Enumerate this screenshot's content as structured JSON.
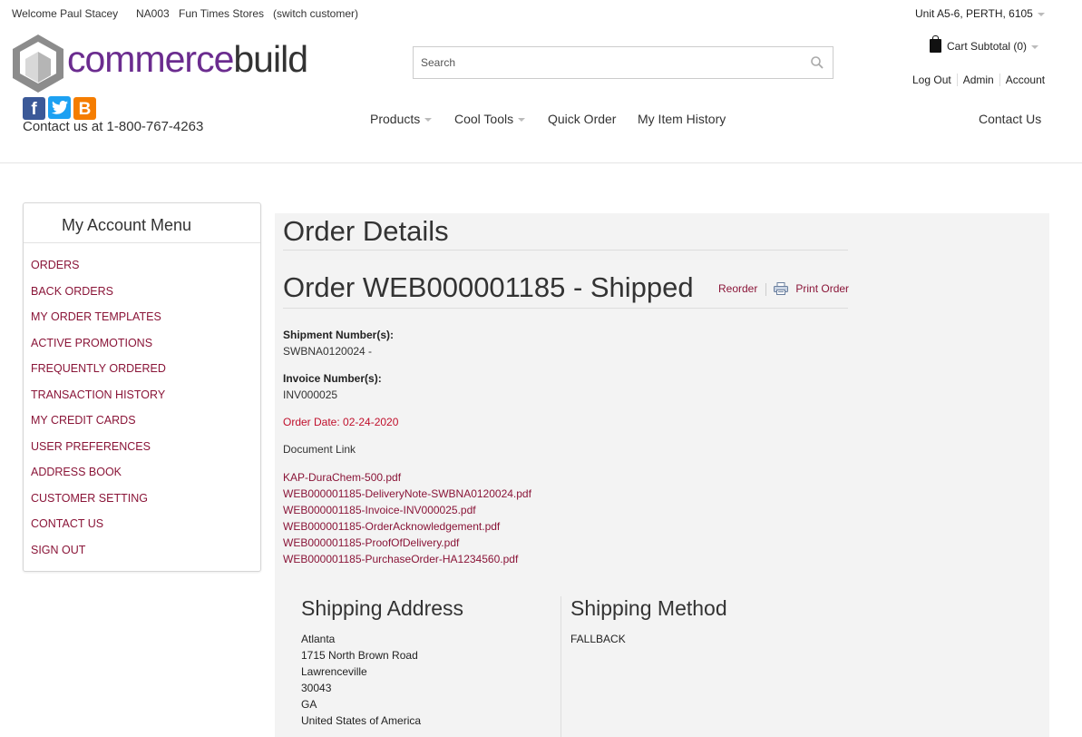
{
  "topbar": {
    "welcome": "Welcome Paul Stacey",
    "customer_code": "NA003",
    "store_name": "Fun Times Stores",
    "switch_label": "(switch customer)",
    "location": "Unit A5-6, PERTH, 6105"
  },
  "logo": {
    "part1": "commerce",
    "part2": "build"
  },
  "social": {
    "facebook": "f",
    "twitter": "t",
    "blogger": "B"
  },
  "contact_line": "Contact us at 1-800-767-4263",
  "search": {
    "placeholder": "Search"
  },
  "cart": {
    "label": "Cart Subtotal (0)"
  },
  "account_links": {
    "logout": "Log Out",
    "admin": "Admin",
    "account": "Account"
  },
  "nav": {
    "products": "Products",
    "cool_tools": "Cool Tools",
    "quick_order": "Quick Order",
    "item_history": "My Item History",
    "contact": "Contact Us"
  },
  "sidebar": {
    "title": "My Account Menu",
    "items": [
      "ORDERS",
      "BACK ORDERS",
      "MY ORDER TEMPLATES",
      "ACTIVE PROMOTIONS",
      "FREQUENTLY ORDERED",
      "TRANSACTION HISTORY",
      "MY CREDIT CARDS",
      "USER PREFERENCES",
      "ADDRESS BOOK",
      "CUSTOMER SETTING",
      "CONTACT US",
      "SIGN OUT"
    ]
  },
  "order": {
    "page_title": "Order Details",
    "title": "Order WEB000001185 - Shipped",
    "reorder": "Reorder",
    "print": "Print Order",
    "shipment_label": "Shipment Number(s):",
    "shipment_value": "SWBNA0120024 -",
    "invoice_label": "Invoice Number(s):",
    "invoice_value": "INV000025",
    "order_date": "Order Date: 02-24-2020",
    "document_link_label": "Document Link",
    "documents": [
      "KAP-DuraChem-500.pdf",
      "WEB000001185-DeliveryNote-SWBNA0120024.pdf",
      "WEB000001185-Invoice-INV000025.pdf",
      "WEB000001185-OrderAcknowledgement.pdf",
      "WEB000001185-ProofOfDelivery.pdf",
      "WEB000001185-PurchaseOrder-HA1234560.pdf"
    ]
  },
  "shipping": {
    "address_title": "Shipping Address",
    "address_lines": [
      "Atlanta",
      "1715 North Brown Road",
      "Lawrenceville",
      "30043",
      "GA",
      "United States of America"
    ],
    "method_title": "Shipping Method",
    "method_value": "FALLBACK"
  },
  "colors": {
    "link": "#8a1538",
    "date_red": "#c0102c",
    "brand_purple": "#6b2c8f"
  }
}
